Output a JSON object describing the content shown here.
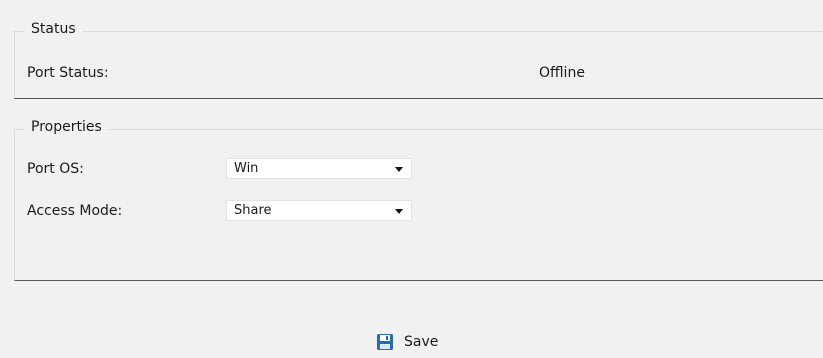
{
  "status": {
    "legend": "Status",
    "port_status_label": "Port Status:",
    "port_status_value": "Offline"
  },
  "properties": {
    "legend": "Properties",
    "port_os_label": "Port OS:",
    "port_os_value": "Win",
    "access_mode_label": "Access Mode:",
    "access_mode_value": "Share"
  },
  "actions": {
    "save_label": "Save",
    "save_icon": "floppy-disk-icon"
  },
  "colors": {
    "background": "#f1f1f1",
    "save_icon": "#2b6cb0"
  }
}
